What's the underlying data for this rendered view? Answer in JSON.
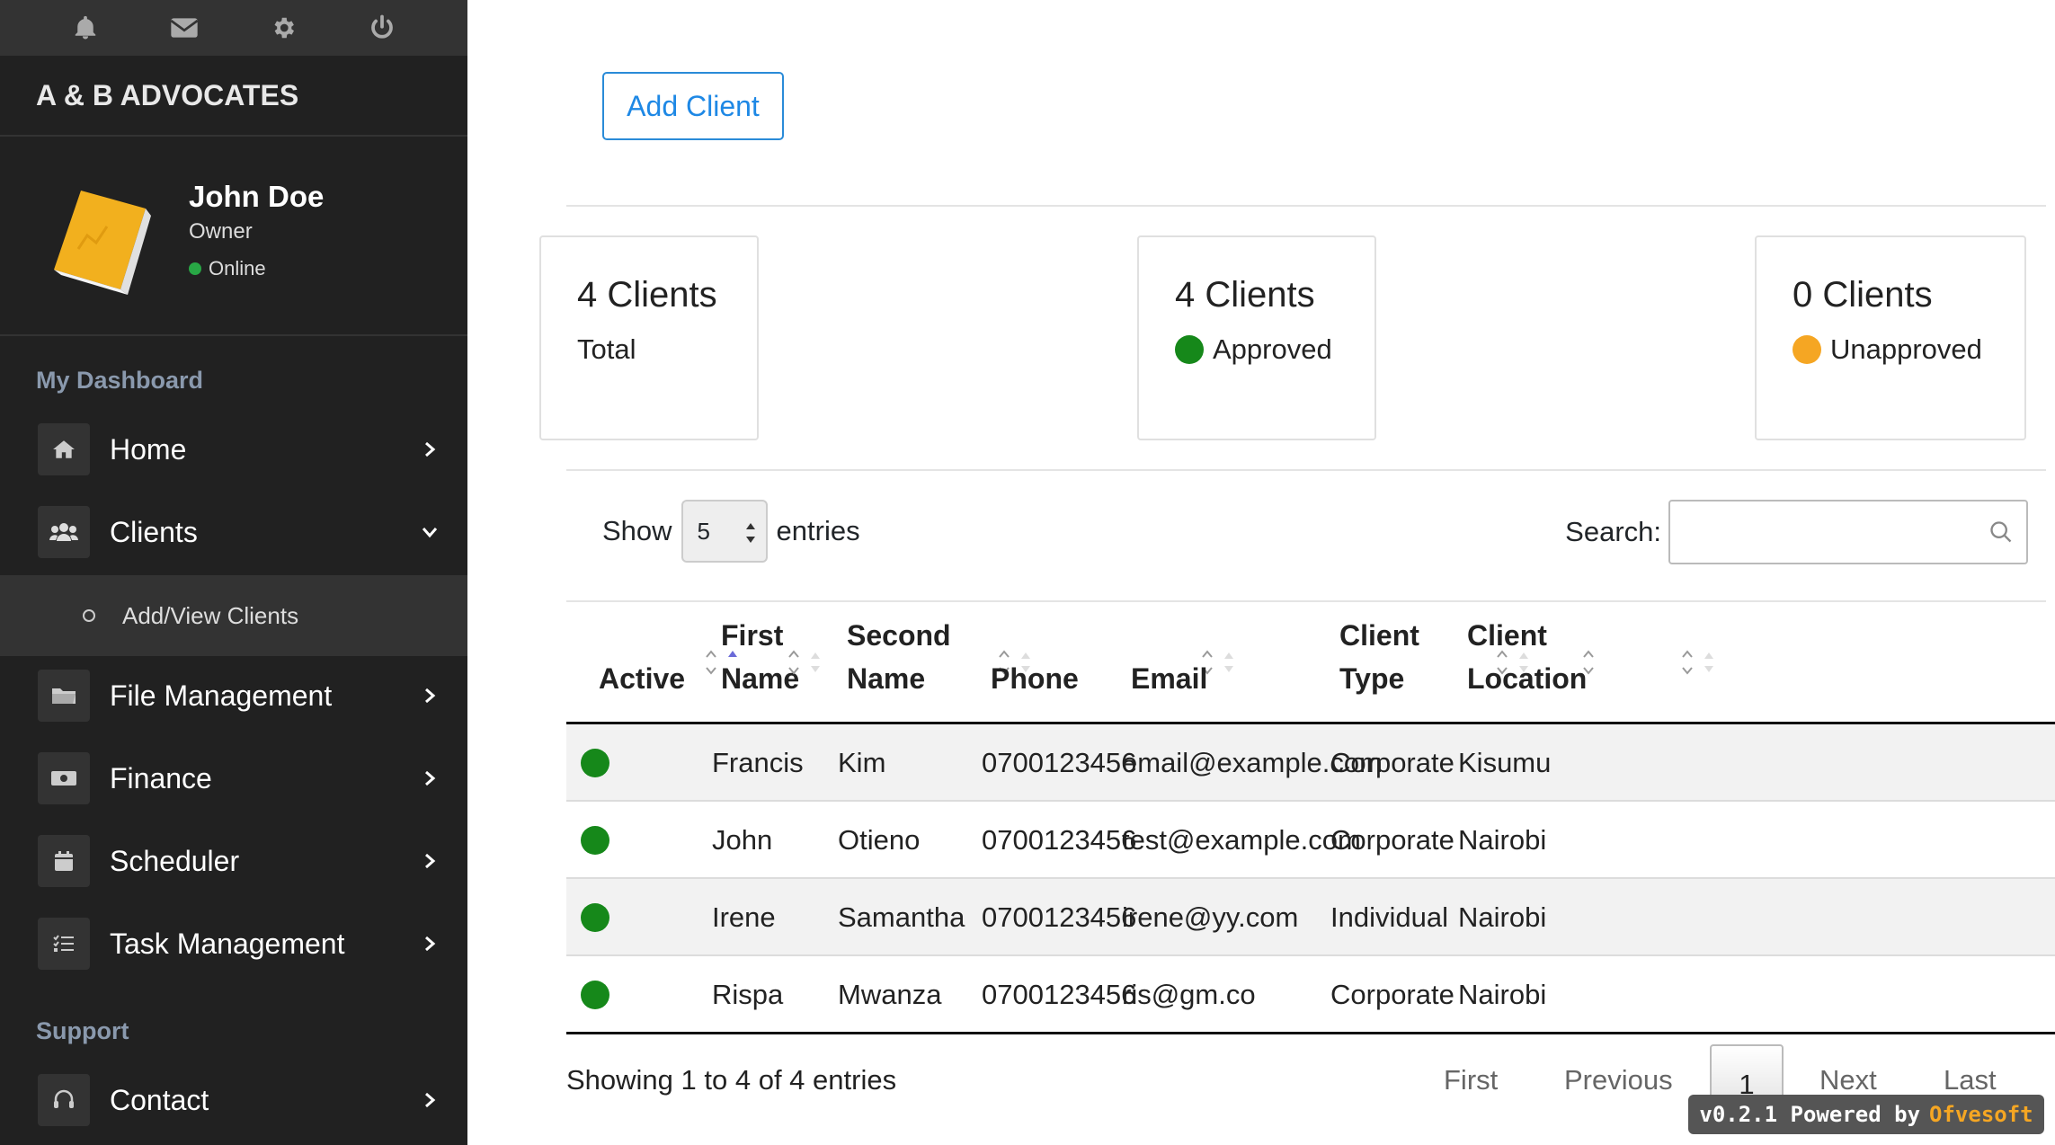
{
  "sidebar": {
    "brand": "A & B ADVOCATES",
    "top_icons": [
      "bell-icon",
      "envelope-icon",
      "gear-icon",
      "power-icon"
    ],
    "user": {
      "name": "John Doe",
      "role": "Owner",
      "status": "Online"
    },
    "sections": {
      "dashboard": "My Dashboard",
      "support": "Support"
    },
    "items": [
      {
        "label": "Home",
        "icon": "home-icon"
      },
      {
        "label": "Clients",
        "icon": "users-icon",
        "expanded": true
      },
      {
        "label": "File Management",
        "icon": "folder-icon"
      },
      {
        "label": "Finance",
        "icon": "money-icon"
      },
      {
        "label": "Scheduler",
        "icon": "calendar-icon"
      },
      {
        "label": "Task Management",
        "icon": "tasks-icon"
      }
    ],
    "subitem": "Add/View Clients",
    "support_item": {
      "label": "Contact",
      "icon": "headset-icon"
    }
  },
  "main": {
    "add_client_label": "Add Client",
    "cards": [
      {
        "count": "4 Clients",
        "label": "Total"
      },
      {
        "count": "4 Clients",
        "label": "Approved",
        "dot_color": "#16881a"
      },
      {
        "count": "0 Clients",
        "label": "Unapproved",
        "dot_color": "#f5a623"
      }
    ],
    "show_label": "Show",
    "entries_value": "5",
    "entries_label": "entries",
    "search_label": "Search:",
    "search_value": "",
    "columns": [
      {
        "line1": "Active",
        "line2": ""
      },
      {
        "line1": "First",
        "line2": "Name"
      },
      {
        "line1": "Second",
        "line2": "Name"
      },
      {
        "line1": "Phone",
        "line2": ""
      },
      {
        "line1": "Email",
        "line2": ""
      },
      {
        "line1": "Client",
        "line2": "Type"
      },
      {
        "line1": "Client",
        "line2": "Location"
      }
    ],
    "rows": [
      {
        "first": "Francis",
        "second": "Kim",
        "phone": "0700123456",
        "email": "email@example.com",
        "type": "Corporate",
        "location": "Kisumu"
      },
      {
        "first": "John",
        "second": "Otieno",
        "phone": "0700123456",
        "email": "test@example.com",
        "type": "Corporate",
        "location": "Nairobi"
      },
      {
        "first": "Irene",
        "second": "Samantha",
        "phone": "0700123456",
        "email": "irene@yy.com",
        "type": "Individual",
        "location": "Nairobi"
      },
      {
        "first": "Rispa",
        "second": "Mwanza",
        "phone": "0700123456",
        "email": "ris@gm.co",
        "type": "Corporate",
        "location": "Nairobi"
      }
    ],
    "info": "Showing 1 to 4 of 4 entries",
    "pager": {
      "first": "First",
      "previous": "Previous",
      "current": "1",
      "next": "Next",
      "last": "Last"
    },
    "powered": {
      "prefix": "v0.2.1 Powered by",
      "brand": "Ofvesoft"
    }
  }
}
